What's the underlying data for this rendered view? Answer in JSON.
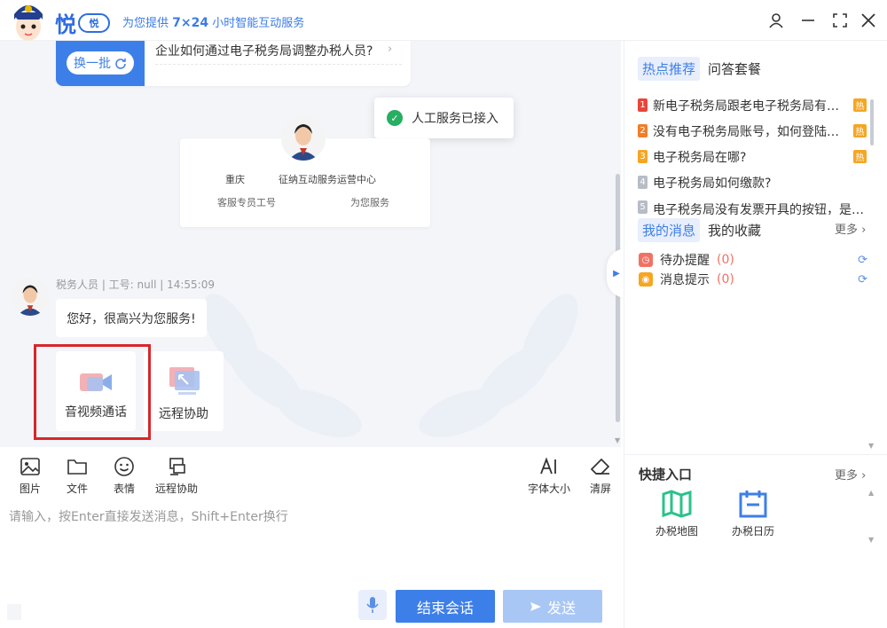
{
  "header": {
    "brand_char": "悦",
    "brand_badge": "悦",
    "tagline_prefix": "为您提供",
    "tagline_bold": "7×24",
    "tagline_suffix": "小时智能互动服务"
  },
  "faq": {
    "swap_label": "换一批",
    "question": "企业如何通过电子税务局调整办税人员?"
  },
  "toast": {
    "text": "人工服务已接入"
  },
  "agent_card": {
    "city": "重庆",
    "center": "征纳互动服务运营中心",
    "id_label": "客服专员工号",
    "serving": "为您服务"
  },
  "message": {
    "meta": "税务人员 | 工号: null | 14:55:09",
    "text": "您好，很高兴为您服务!"
  },
  "tool_tiles": [
    {
      "label": "音视频通话",
      "icon": "video-camera-icon"
    },
    {
      "label": "远程协助",
      "icon": "remote-screen-icon"
    }
  ],
  "toolbar": {
    "items": [
      {
        "label": "图片",
        "icon": "image-icon"
      },
      {
        "label": "文件",
        "icon": "folder-icon"
      },
      {
        "label": "表情",
        "icon": "smiley-icon"
      },
      {
        "label": "远程协助",
        "icon": "remote-assist-icon"
      }
    ],
    "font_size_label": "字体大小",
    "clear_label": "清屏"
  },
  "input": {
    "placeholder": "请输入，按Enter直接发送消息，Shift+Enter换行"
  },
  "buttons": {
    "end_session": "结束会话",
    "send": "发送"
  },
  "right_panel": {
    "hot_tabs": [
      "热点推荐",
      "问答套餐"
    ],
    "hot_items": [
      {
        "rank": "1",
        "text": "新电子税务局跟老电子税务局有什么区别?",
        "tag": "热",
        "color": "#e8463a"
      },
      {
        "rank": "2",
        "text": "没有电子税务局账号，如何登陆新电子税务局?",
        "tag": "热",
        "color": "#f07e2a"
      },
      {
        "rank": "3",
        "text": "电子税务局在哪?",
        "tag": "热",
        "color": "#f5a623"
      },
      {
        "rank": "4",
        "text": "电子税务局如何缴款?",
        "tag": "",
        "color": "#b7bcc6"
      },
      {
        "rank": "5",
        "text": "电子税务局没有发票开具的按钮，是什么原因?",
        "tag": "",
        "color": "#b7bcc6"
      }
    ],
    "msg_tabs": [
      "我的消息",
      "我的收藏"
    ],
    "more_label": "更多",
    "messages": [
      {
        "label": "待办提醒",
        "count": "(0)",
        "icon": "clock-icon",
        "color": "#f07264"
      },
      {
        "label": "消息提示",
        "count": "(0)",
        "icon": "bulb-icon",
        "color": "#f5a623"
      }
    ],
    "quick_title": "快捷入口",
    "quick_more": "更多",
    "quick_items": [
      {
        "label": "办税地图",
        "icon": "map-icon",
        "color": "#2bc28a"
      },
      {
        "label": "办税日历",
        "icon": "calendar-icon",
        "color": "#3d7fe8"
      }
    ]
  }
}
